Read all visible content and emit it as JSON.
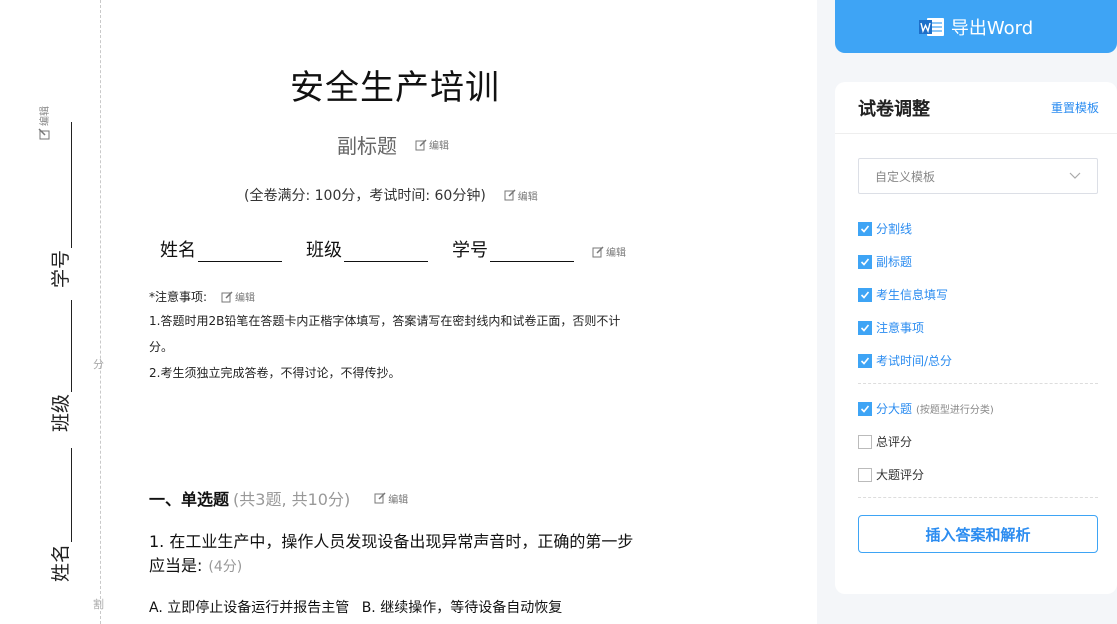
{
  "binding": {
    "edit_label": "编辑",
    "student_id_label": "学号",
    "class_label": "班级",
    "name_label": "姓名",
    "cut_mark_1": "分",
    "cut_mark_2": "割"
  },
  "paper": {
    "title": "安全生产培训",
    "subtitle": "副标题",
    "score_info": "(全卷满分: 100分，考试时间: 60分钟)",
    "info_fields": {
      "name": "姓名",
      "class": "班级",
      "student_id": "学号"
    },
    "edit_label": "编辑",
    "notes": {
      "heading": "*注意事项:",
      "items": [
        "1.答题时用2B铅笔在答题卡内正楷字体填写，答案请写在密封线内和试卷正面，否则不计分。",
        "2.考生须独立完成答卷，不得讨论，不得传抄。"
      ]
    },
    "section": {
      "title": "一、单选题",
      "meta": "(共3题, 共10分)"
    },
    "question1": {
      "text": "1. 在工业生产中，操作人员发现设备出现异常声音时，正确的第一步应当是:",
      "points": "(4分)",
      "options": [
        "A. 立即停止设备运行并报告主管",
        "B. 继续操作，等待设备自动恢复"
      ]
    }
  },
  "right_panel": {
    "export_label": "导出Word",
    "title": "试卷调整",
    "reset_label": "重置模板",
    "template_select": "自定义模板",
    "checkboxes_group1": [
      {
        "label": "分割线",
        "checked": true
      },
      {
        "label": "副标题",
        "checked": true
      },
      {
        "label": "考生信息填写",
        "checked": true
      },
      {
        "label": "注意事项",
        "checked": true
      },
      {
        "label": "考试时间/总分",
        "checked": true
      }
    ],
    "checkboxes_group2": [
      {
        "label": "分大题",
        "hint": "(按题型进行分类)",
        "checked": true
      },
      {
        "label": "总评分",
        "checked": false
      },
      {
        "label": "大题评分",
        "checked": false
      }
    ],
    "insert_label": "插入答案和解析"
  },
  "colors": {
    "accent": "#3ea4f5",
    "link": "#2b8cf0",
    "background": "#f4f6f9"
  }
}
